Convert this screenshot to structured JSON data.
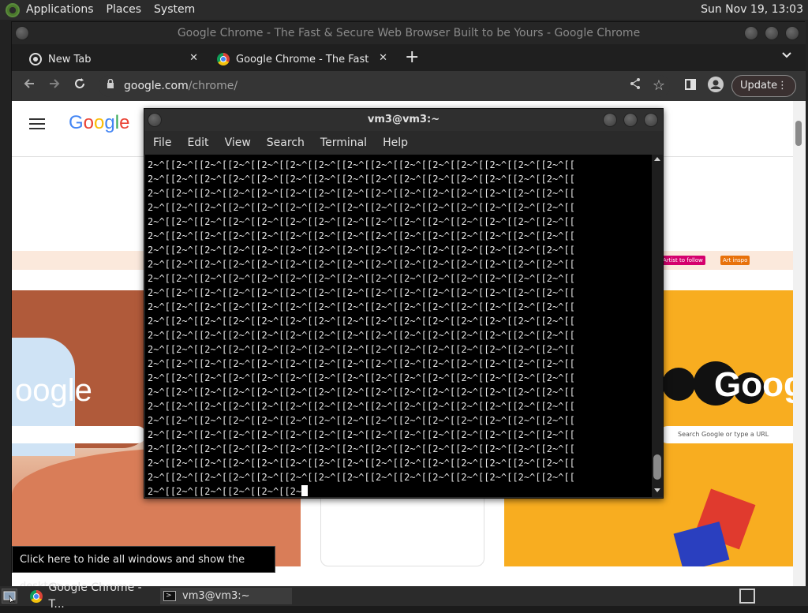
{
  "top_panel": {
    "menus": [
      "Applications",
      "Places",
      "System"
    ],
    "clock": "Sun Nov 19, 13:03"
  },
  "chrome": {
    "window_title": "Google Chrome - The Fast & Secure Web Browser Built to be Yours - Google Chrome",
    "tabs": [
      {
        "label": "New Tab",
        "close": "✕"
      },
      {
        "label": "Google Chrome - The Fast & S",
        "close": "✕"
      }
    ],
    "new_tab": "+",
    "url_host": "google.com",
    "url_path": "/chrome/",
    "update_label": "Update",
    "page": {
      "logo_text": "Google C",
      "chips": [
        "Artist to follow",
        "Art inspo"
      ],
      "left_logo": "oogle",
      "right_logo": "Goog",
      "right_search_placeholder": "Search Google or type a URL"
    }
  },
  "terminal": {
    "title": "vm3@vm3:~",
    "menus": [
      "File",
      "Edit",
      "View",
      "Search",
      "Terminal",
      "Help"
    ],
    "lines": [
      "2~^[[2~^[[2~^[[2~^[[2~^[[2~^[[2~^[[2~^[[2~^[[2~^[[2~^[[2~^[[2~^[[2~^[[2~^[[",
      "2~^[[2~^[[2~^[[2~^[[2~^[[2~^[[2~^[[2~^[[2~^[[2~^[[2~^[[2~^[[2~^[[2~^[[2~^[[",
      "2~^[[2~^[[2~^[[2~^[[2~^[[2~^[[2~^[[2~^[[2~^[[2~^[[2~^[[2~^[[2~^[[2~^[[2~^[[",
      "2~^[[2~^[[2~^[[2~^[[2~^[[2~^[[2~^[[2~^[[2~^[[2~^[[2~^[[2~^[[2~^[[2~^[[2~^[[",
      "2~^[[2~^[[2~^[[2~^[[2~^[[2~^[[2~^[[2~^[[2~^[[2~^[[2~^[[2~^[[2~^[[2~^[[2~^[[",
      "2~^[[2~^[[2~^[[2~^[[2~^[[2~^[[2~^[[2~^[[2~^[[2~^[[2~^[[2~^[[2~^[[2~^[[2~^[[",
      "2~^[[2~^[[2~^[[2~^[[2~^[[2~^[[2~^[[2~^[[2~^[[2~^[[2~^[[2~^[[2~^[[2~^[[2~^[[",
      "2~^[[2~^[[2~^[[2~^[[2~^[[2~^[[2~^[[2~^[[2~^[[2~^[[2~^[[2~^[[2~^[[2~^[[2~^[[",
      "2~^[[2~^[[2~^[[2~^[[2~^[[2~^[[2~^[[2~^[[2~^[[2~^[[2~^[[2~^[[2~^[[2~^[[2~^[[",
      "2~^[[2~^[[2~^[[2~^[[2~^[[2~^[[2~^[[2~^[[2~^[[2~^[[2~^[[2~^[[2~^[[2~^[[2~^[[",
      "2~^[[2~^[[2~^[[2~^[[2~^[[2~^[[2~^[[2~^[[2~^[[2~^[[2~^[[2~^[[2~^[[2~^[[2~^[[",
      "2~^[[2~^[[2~^[[2~^[[2~^[[2~^[[2~^[[2~^[[2~^[[2~^[[2~^[[2~^[[2~^[[2~^[[2~^[[",
      "2~^[[2~^[[2~^[[2~^[[2~^[[2~^[[2~^[[2~^[[2~^[[2~^[[2~^[[2~^[[2~^[[2~^[[2~^[[",
      "2~^[[2~^[[2~^[[2~^[[2~^[[2~^[[2~^[[2~^[[2~^[[2~^[[2~^[[2~^[[2~^[[2~^[[2~^[[",
      "2~^[[2~^[[2~^[[2~^[[2~^[[2~^[[2~^[[2~^[[2~^[[2~^[[2~^[[2~^[[2~^[[2~^[[2~^[[",
      "2~^[[2~^[[2~^[[2~^[[2~^[[2~^[[2~^[[2~^[[2~^[[2~^[[2~^[[2~^[[2~^[[2~^[[2~^[[",
      "2~^[[2~^[[2~^[[2~^[[2~^[[2~^[[2~^[[2~^[[2~^[[2~^[[2~^[[2~^[[2~^[[2~^[[2~^[[",
      "2~^[[2~^[[2~^[[2~^[[2~^[[2~^[[2~^[[2~^[[2~^[[2~^[[2~^[[2~^[[2~^[[2~^[[2~^[[",
      "2~^[[2~^[[2~^[[2~^[[2~^[[2~^[[2~^[[2~^[[2~^[[2~^[[2~^[[2~^[[2~^[[2~^[[2~^[[",
      "2~^[[2~^[[2~^[[2~^[[2~^[[2~^[[2~^[[2~^[[2~^[[2~^[[2~^[[2~^[[2~^[[2~^[[2~^[[",
      "2~^[[2~^[[2~^[[2~^[[2~^[[2~^[[2~^[[2~^[[2~^[[2~^[[2~^[[2~^[[2~^[[2~^[[2~^[[",
      "2~^[[2~^[[2~^[[2~^[[2~^[[2~^[[2~^[[2~^[[2~^[[2~^[[2~^[[2~^[[2~^[[2~^[[2~^[[",
      "2~^[[2~^[[2~^[[2~^[[2~^[[2~^[[2~^[[2~^[[2~^[[2~^[[2~^[[2~^[[2~^[[2~^[[2~^[["
    ],
    "last_line": "2~^[[2~^[[2~^[[2~^[[2~^[[2~"
  },
  "tooltip": "Click here to hide all windows and show the desktop.",
  "taskbar": {
    "items": [
      {
        "label": "Google Chrome - T..."
      },
      {
        "label": "vm3@vm3:~"
      }
    ]
  }
}
